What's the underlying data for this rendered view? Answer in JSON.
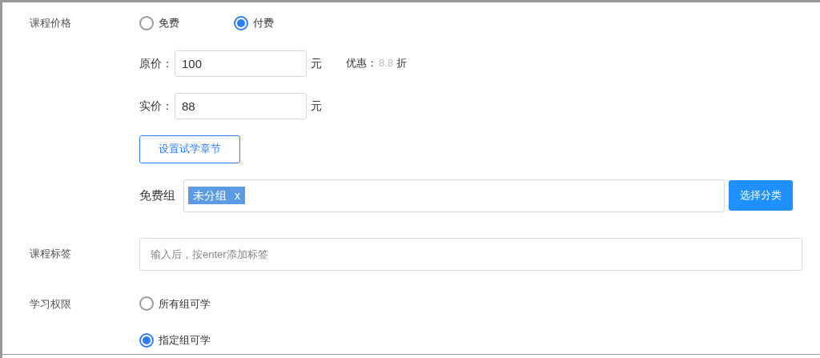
{
  "price": {
    "label": "课程价格",
    "options": [
      {
        "label": "免费",
        "selected": false
      },
      {
        "label": "付费",
        "selected": true
      }
    ],
    "original": {
      "label": "原价：",
      "value": "100",
      "unit": "元"
    },
    "discount": {
      "label": "优惠：",
      "value": "8.8",
      "unit": "折"
    },
    "actual": {
      "label": "实价：",
      "value": "88",
      "unit": "元"
    },
    "trial_button": "设置试学章节",
    "free_group": {
      "label": "免费组",
      "tags": [
        {
          "label": "未分组",
          "remove": "x"
        }
      ],
      "button": "选择分类"
    }
  },
  "tags": {
    "label": "课程标签",
    "placeholder": "输入后，按enter添加标签"
  },
  "permission": {
    "label": "学习权限",
    "options": [
      {
        "label": "所有组可学",
        "selected": false
      },
      {
        "label": "指定组可学",
        "selected": true
      }
    ]
  }
}
